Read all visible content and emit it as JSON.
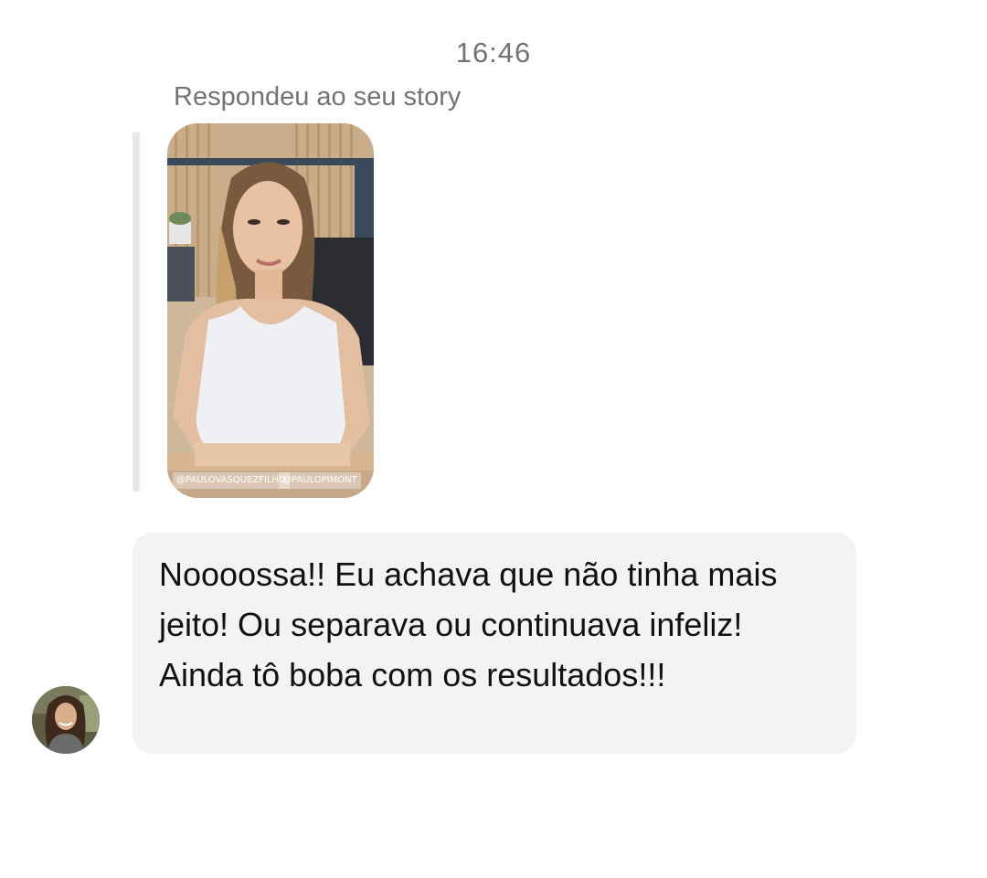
{
  "chat": {
    "timestamp": "16:46",
    "reply_label": "Respondeu ao seu story",
    "story": {
      "tag_left": "@PAULOVASQUEZFILHO",
      "tag_right": "@PAULOPIMONT"
    },
    "message": {
      "text": "Noooossa!! Eu achava que não tinha mais jeito! Ou separava ou continuava infeliz! Ainda tô boba com os resultados!!!"
    }
  },
  "colors": {
    "background": "#ffffff",
    "bubble": "#f3f3f3",
    "muted_text": "#737373",
    "message_text": "#111111"
  }
}
